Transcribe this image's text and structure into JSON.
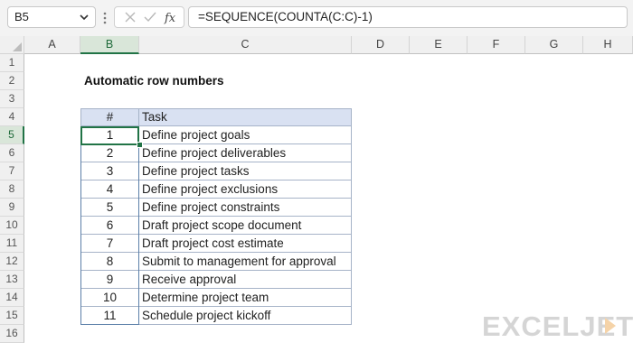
{
  "formula_bar": {
    "name_box": "B5",
    "formula": "=SEQUENCE(COUNTA(C:C)-1)"
  },
  "columns": [
    "A",
    "B",
    "C",
    "D",
    "E",
    "F",
    "G",
    "H"
  ],
  "rows": [
    "1",
    "2",
    "3",
    "4",
    "5",
    "6",
    "7",
    "8",
    "9",
    "10",
    "11",
    "12",
    "13",
    "14",
    "15",
    "16"
  ],
  "sheet": {
    "title": "Automatic row numbers",
    "header_num": "#",
    "header_task": "Task",
    "data": [
      {
        "n": "1",
        "task": "Define project goals"
      },
      {
        "n": "2",
        "task": "Define project deliverables"
      },
      {
        "n": "3",
        "task": "Define project tasks"
      },
      {
        "n": "4",
        "task": "Define project exclusions"
      },
      {
        "n": "5",
        "task": "Define project constraints"
      },
      {
        "n": "6",
        "task": "Draft project scope document"
      },
      {
        "n": "7",
        "task": "Draft project cost estimate"
      },
      {
        "n": "8",
        "task": "Submit to management for approval"
      },
      {
        "n": "9",
        "task": "Receive approval"
      },
      {
        "n": "10",
        "task": "Determine project team"
      },
      {
        "n": "11",
        "task": "Schedule project kickoff"
      }
    ]
  },
  "watermark": "EXCELJET",
  "colors": {
    "accent": "#217346",
    "header_fill": "#d9e1f2"
  }
}
